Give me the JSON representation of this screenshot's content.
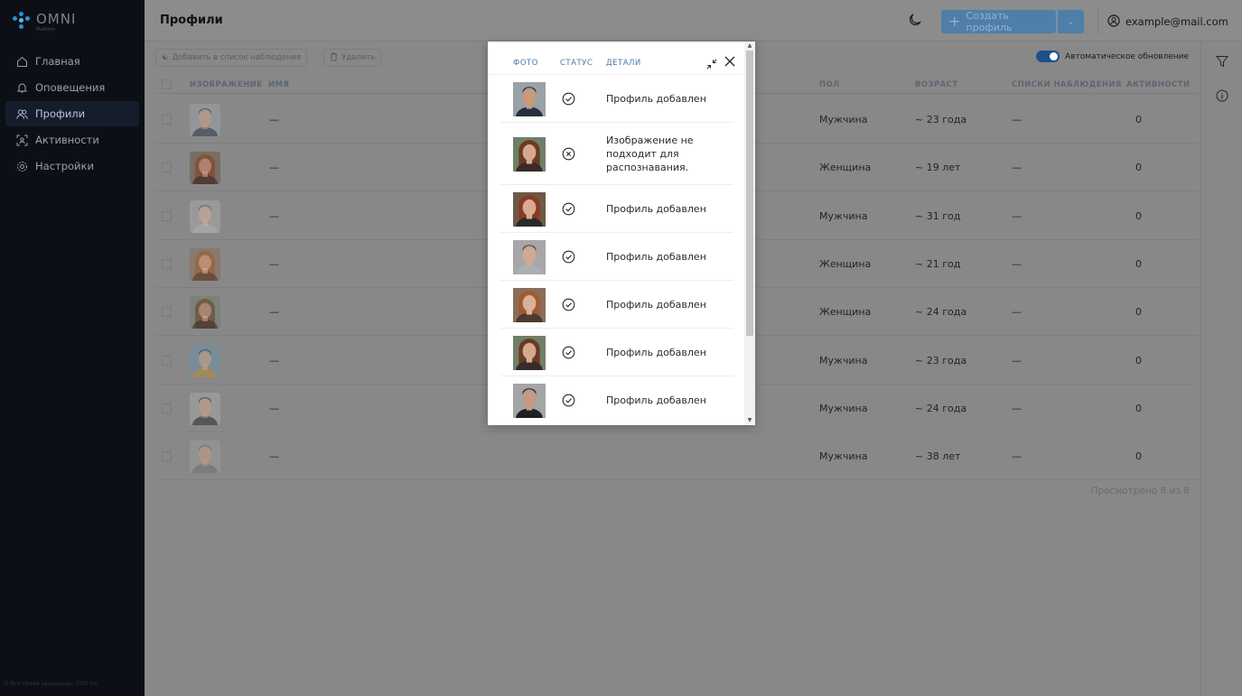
{
  "app": {
    "logo_text": "OMNI",
    "logo_sub": "Platform"
  },
  "sidebar": {
    "items": [
      {
        "label": "Главная",
        "icon": "home-icon"
      },
      {
        "label": "Оповещения",
        "icon": "bell-icon"
      },
      {
        "label": "Профили",
        "icon": "profiles-icon"
      },
      {
        "label": "Активности",
        "icon": "activity-icon"
      },
      {
        "label": "Настройки",
        "icon": "settings-icon"
      }
    ],
    "active_index": 2,
    "copyright": "© Все права защищены. TDVi Inc."
  },
  "header": {
    "title": "Профили",
    "create_label": "Создать профиль",
    "user_email": "example@mail.com"
  },
  "toolbar": {
    "add_watchlist_label": "Добавить в список наблюдения",
    "delete_label": "Удалить",
    "auto_update_label": "Автоматическое обновление",
    "auto_update_on": true
  },
  "table": {
    "columns": [
      "ИЗОБРАЖЕНИЕ",
      "ИМЯ",
      "ПОЛ",
      "ВОЗРАСТ",
      "СПИСКИ НАБЛЮДЕНИЯ",
      "АКТИВНОСТИ"
    ],
    "rows": [
      {
        "name": "—",
        "gender": "Мужчина",
        "age": "~ 23 года",
        "watchlists": "—",
        "activities": "0"
      },
      {
        "name": "—",
        "gender": "Женщина",
        "age": "~ 19 лет",
        "watchlists": "—",
        "activities": "0"
      },
      {
        "name": "—",
        "gender": "Мужчина",
        "age": "~ 31 год",
        "watchlists": "—",
        "activities": "0"
      },
      {
        "name": "—",
        "gender": "Женщина",
        "age": "~ 21 год",
        "watchlists": "—",
        "activities": "0"
      },
      {
        "name": "—",
        "gender": "Женщина",
        "age": "~ 24 года",
        "watchlists": "—",
        "activities": "0"
      },
      {
        "name": "—",
        "gender": "Мужчина",
        "age": "~ 23 года",
        "watchlists": "—",
        "activities": "0"
      },
      {
        "name": "—",
        "gender": "Мужчина",
        "age": "~ 24 года",
        "watchlists": "—",
        "activities": "0"
      },
      {
        "name": "—",
        "gender": "Мужчина",
        "age": "~ 38 лет",
        "watchlists": "—",
        "activities": "0"
      }
    ],
    "viewed_text": "Просмотрено 8 из 8"
  },
  "modal": {
    "columns": [
      "ФОТО",
      "СТАТУС",
      "ДЕТАЛИ"
    ],
    "rows": [
      {
        "status": "success",
        "detail": "Профиль добавлен"
      },
      {
        "status": "error",
        "detail": "Изображение не подходит для распознавания."
      },
      {
        "status": "success",
        "detail": "Профиль добавлен"
      },
      {
        "status": "success",
        "detail": "Профиль добавлен"
      },
      {
        "status": "success",
        "detail": "Профиль добавлен"
      },
      {
        "status": "success",
        "detail": "Профиль добавлен"
      },
      {
        "status": "success",
        "detail": "Профиль добавлен"
      }
    ]
  },
  "colors": {
    "accent": "#1f6fc7",
    "sidebar_bg": "#0c0f15",
    "overlay": "#888888"
  }
}
